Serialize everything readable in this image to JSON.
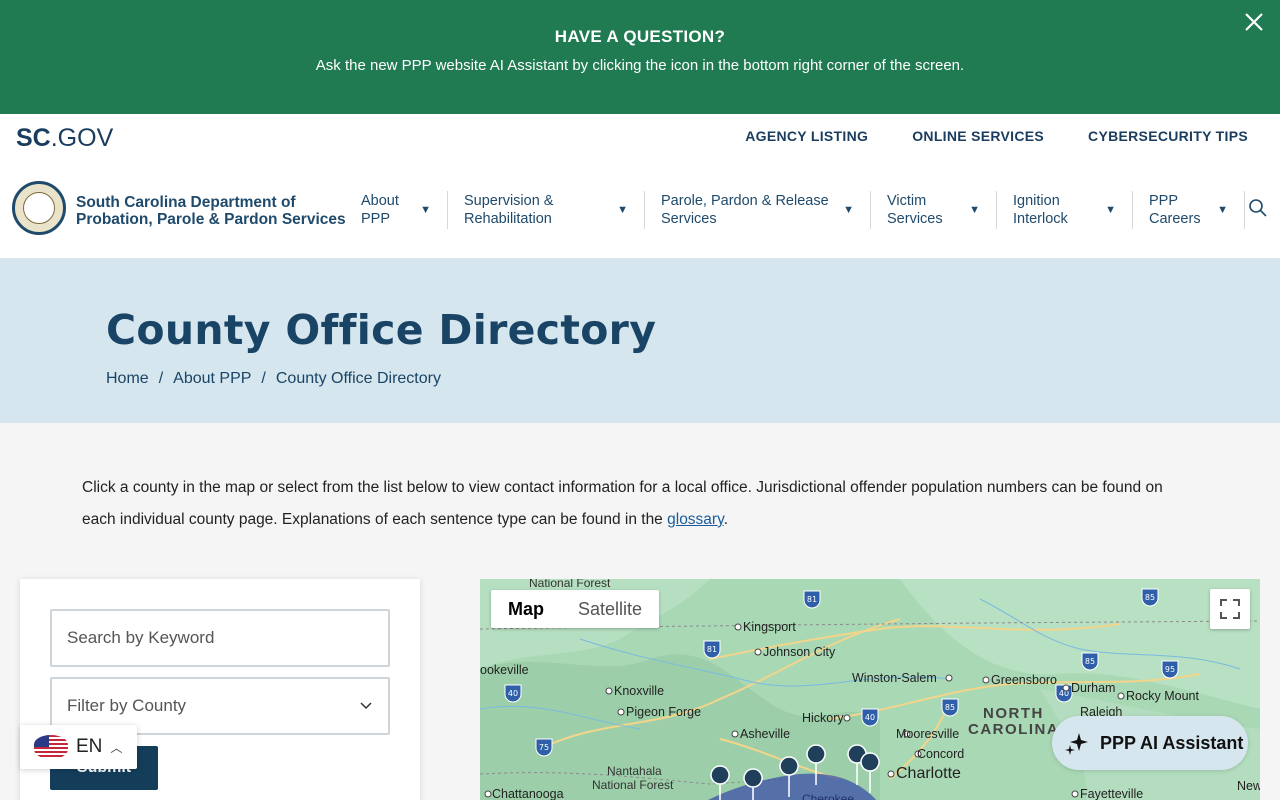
{
  "banner": {
    "title": "HAVE A QUESTION?",
    "text": "Ask the new PPP website AI Assistant by clicking the icon in the bottom right corner of the screen."
  },
  "utility": {
    "logo_sc": "SC",
    "logo_gov": ".GOV",
    "links": [
      "AGENCY LISTING",
      "ONLINE SERVICES",
      "CYBERSECURITY TIPS"
    ]
  },
  "header": {
    "org_line1": "South Carolina Department of",
    "org_line2": "Probation, Parole & Pardon Services",
    "nav": [
      {
        "line1": "About",
        "line2": "PPP"
      },
      {
        "line1": "Supervision &",
        "line2": "Rehabilitation"
      },
      {
        "line1": "Parole, Pardon & Release",
        "line2": "Services"
      },
      {
        "line1": "Victim",
        "line2": "Services"
      },
      {
        "line1": "Ignition",
        "line2": "Interlock"
      },
      {
        "line1": "PPP",
        "line2": "Careers"
      }
    ]
  },
  "hero": {
    "title": "County Office Directory",
    "breadcrumb": [
      "Home",
      "About PPP",
      "County Office Directory"
    ]
  },
  "intro": {
    "text_before": "Click a county in the map or select from the list below to view contact information for a local office. Jurisdictional offender population numbers can be found on each individual county page. Explanations of each sentence type can be found in the ",
    "link": "glossary",
    "text_after": "."
  },
  "filters": {
    "keyword_placeholder": "Search by Keyword",
    "county_placeholder": "Filter by County",
    "submit_label": "Submit"
  },
  "language": {
    "code": "EN"
  },
  "map": {
    "tabs": [
      "Map",
      "Satellite"
    ],
    "labels": {
      "national_forest": "National Forest",
      "kingsport": "Kingsport",
      "johnson_city": "Johnson City",
      "nookeville": "ookeville",
      "knoxville": "Knoxville",
      "winston_salem": "Winston-Salem",
      "greensboro": "Greensboro",
      "durham": "Durham",
      "rocky_mount": "Rocky Mount",
      "pigeon_forge": "Pigeon Forge",
      "hickory": "Hickory",
      "north": "NORTH",
      "carolina": "CAROLINA",
      "raleigh": "Raleigh",
      "asheville": "Asheville",
      "mooresville": "Mooresville",
      "concord": "Concord",
      "charlotte": "Charlotte",
      "nantahala": "Nantahala",
      "national_forest_2": "National Forest",
      "chattanooga": "Chattanooga",
      "fayetteville": "Fayetteville",
      "cherokee": "Cherokee",
      "new": "New"
    },
    "highways": [
      "81",
      "85",
      "81",
      "40",
      "85",
      "95",
      "40",
      "85",
      "40",
      "75"
    ]
  },
  "ai": {
    "label": "PPP AI Assistant"
  }
}
